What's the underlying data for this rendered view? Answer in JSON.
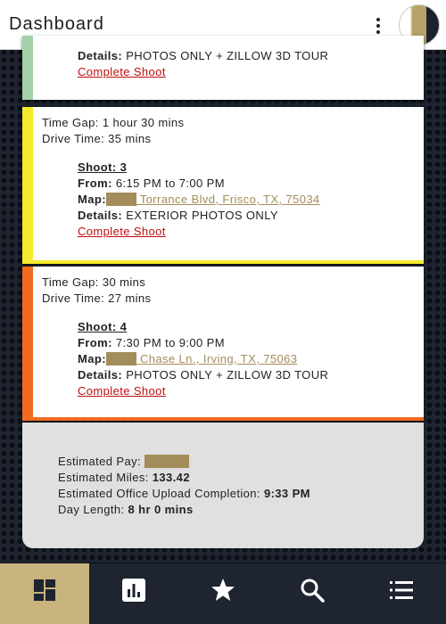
{
  "header": {
    "title": "Dashboard",
    "menu_icon": "more-vert-icon",
    "avatar": "profile-avatar"
  },
  "colors": {
    "accent_gold": "#c8b27d",
    "link_gold": "#a38d5a",
    "complete_red": "#c00d0d",
    "green_stripe": "#a3d0a6",
    "yellow_stripe": "#f5eb2c",
    "orange_stripe": "#f06a22"
  },
  "cards": [
    {
      "details_label": "Details:",
      "details": "PHOTOS ONLY + ZILLOW 3D TOUR",
      "action": "Complete Shoot"
    },
    {
      "time_gap": "Time Gap: 1 hour 30 mins",
      "drive_time": "Drive Time: 35 mins",
      "shoot_title": "Shoot: 3",
      "from_label": "From:",
      "from": "6:15 PM to 7:00 PM",
      "map_label": "Map:",
      "map": " Torrance Blvd, Frisco, TX, 75034",
      "details_label": "Details:",
      "details": "EXTERIOR PHOTOS ONLY",
      "action": "Complete Shoot"
    },
    {
      "time_gap": "Time Gap: 30 mins",
      "drive_time": "Drive Time: 27 mins",
      "shoot_title": "Shoot: 4",
      "from_label": "From:",
      "from": "7:30 PM to 9:00 PM",
      "map_label": "Map:",
      "map": " Chase Ln., Irving, TX, 75063",
      "details_label": "Details:",
      "details": "PHOTOS ONLY + ZILLOW 3D TOUR",
      "action": "Complete Shoot"
    }
  ],
  "summary": {
    "pay_label": "Estimated Pay:",
    "miles_label": "Estimated Miles:",
    "miles": "133.42",
    "upload_label": "Estimated Office Upload Completion:",
    "upload": "9:33 PM",
    "day_label": "Day Length:",
    "day": "8 hr 0 mins"
  },
  "nav": [
    {
      "icon": "dashboard-icon",
      "active": true
    },
    {
      "icon": "bar-chart-icon",
      "active": false
    },
    {
      "icon": "star-icon",
      "active": false
    },
    {
      "icon": "search-icon",
      "active": false
    },
    {
      "icon": "list-icon",
      "active": false
    }
  ]
}
